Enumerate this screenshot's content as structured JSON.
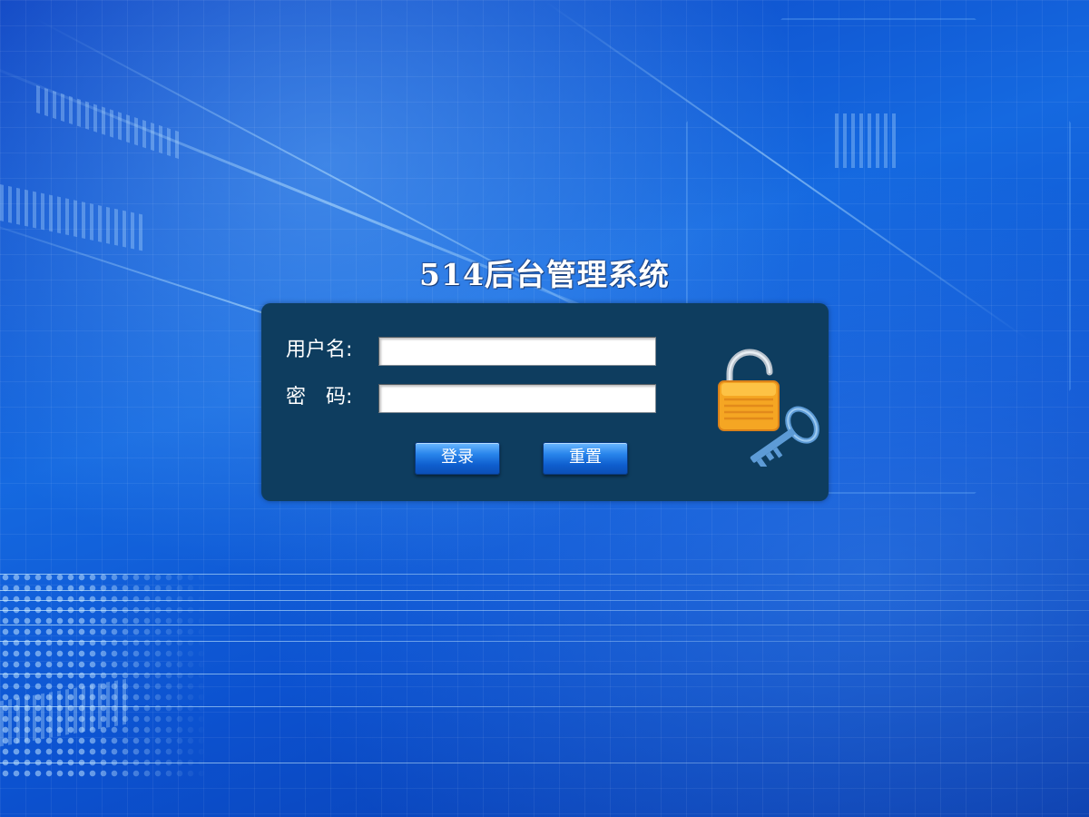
{
  "page": {
    "title": "514后台管理系统"
  },
  "login": {
    "username_label": "用户名:",
    "username_value": "",
    "password_label": "密　码:",
    "password_value": "",
    "login_button": "登录",
    "reset_button": "重置"
  },
  "colors": {
    "panel_bg": "#0e3d5f",
    "page_bg": "#1569e0",
    "button": "#2a86ec",
    "lock_body": "#f5a623",
    "key": "#6fa8dc"
  },
  "icons": {
    "lock": "padlock-open-icon",
    "key": "key-icon"
  }
}
